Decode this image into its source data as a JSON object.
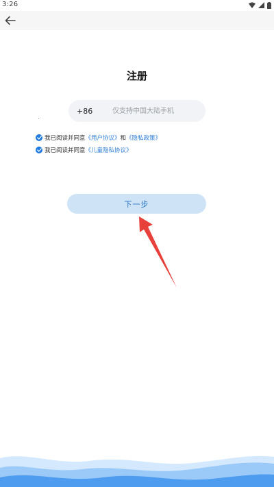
{
  "status_bar": {
    "time": "3:26",
    "icons": [
      "wifi-icon",
      "signal-icon",
      "battery-icon"
    ]
  },
  "app_bar": {
    "back_icon": "arrow-left-icon"
  },
  "page_title": "注册",
  "phone": {
    "country_code": "+86",
    "placeholder": "仅支持中国大陆手机",
    "value": ""
  },
  "consents": [
    {
      "checked": true,
      "prefix": "我已阅读并同意",
      "link1": "《用户协议》",
      "conjunction": "和",
      "link2": "《隐私政策》"
    },
    {
      "checked": true,
      "prefix": "我已阅读并同意",
      "link1": "《儿童隐私协议》"
    }
  ],
  "next_button": {
    "label": "下一步"
  },
  "colors": {
    "primary": "#1f7ae0",
    "link": "#2f7fd7",
    "button_bg": "#cfe3f6",
    "button_text": "#2b73c2",
    "annotation_arrow": "#e8403a",
    "wave_light": "#bcdcfb",
    "wave_dark": "#4d9cf0"
  }
}
